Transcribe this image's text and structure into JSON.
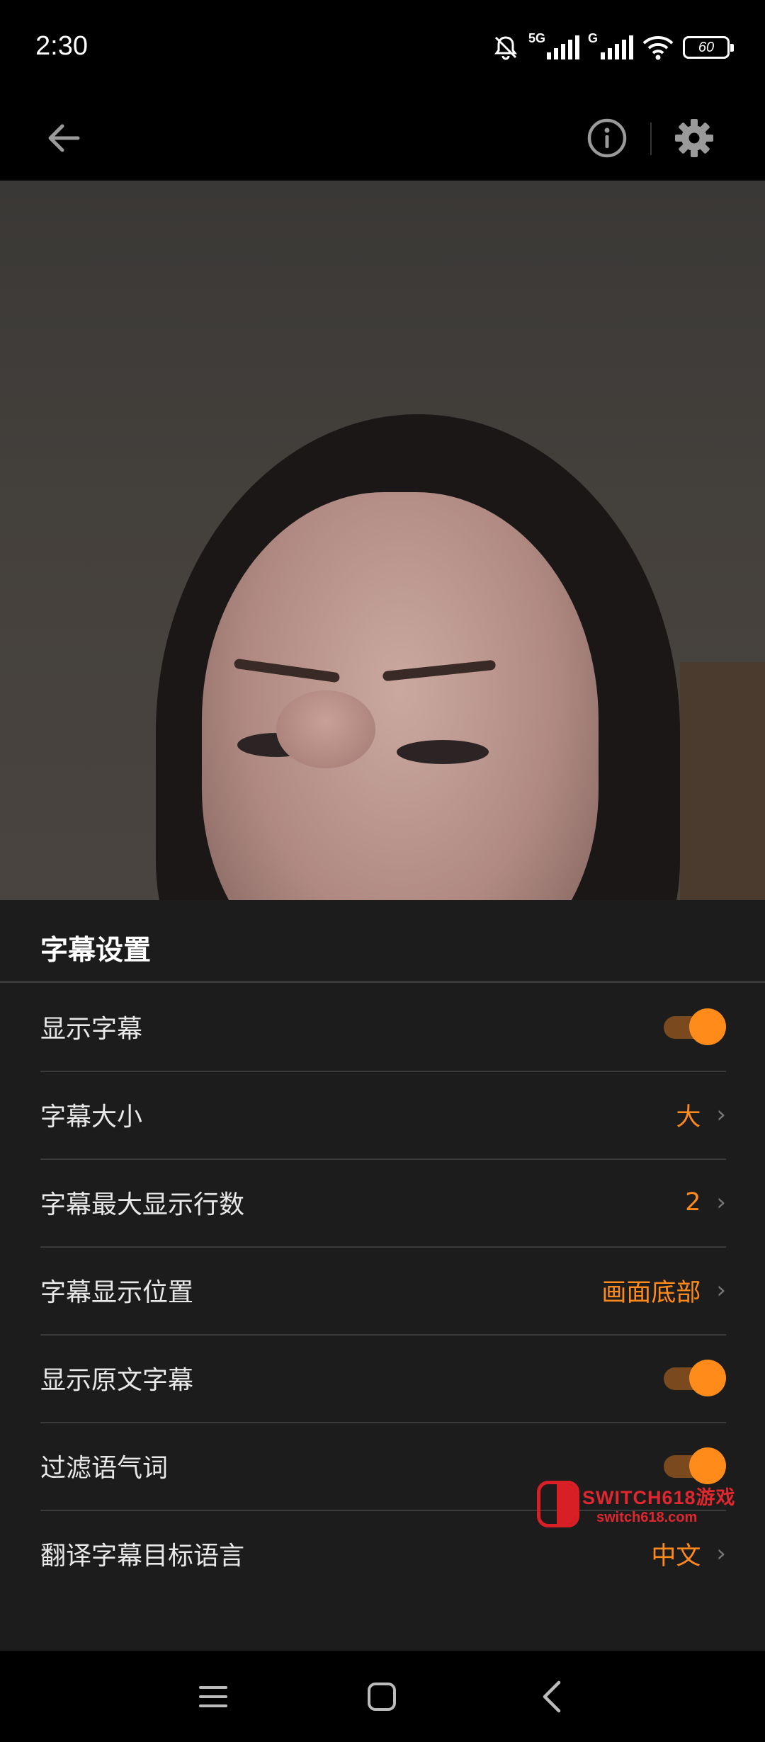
{
  "status_bar": {
    "time": "2:30",
    "network_1": "5G",
    "network_2": "G",
    "battery": "60"
  },
  "toolbar": {
    "icons": [
      "back-arrow-icon",
      "info-icon",
      "gear-icon"
    ]
  },
  "settings": {
    "title": "字幕设置",
    "rows": [
      {
        "label": "显示字幕",
        "type": "toggle",
        "on": true
      },
      {
        "label": "字幕大小",
        "type": "value",
        "value": "大"
      },
      {
        "label": "字幕最大显示行数",
        "type": "value",
        "value": "2"
      },
      {
        "label": "字幕显示位置",
        "type": "value",
        "value": "画面底部"
      },
      {
        "label": "显示原文字幕",
        "type": "toggle",
        "on": true
      },
      {
        "label": "过滤语气词",
        "type": "toggle",
        "on": true
      },
      {
        "label": "翻译字幕目标语言",
        "type": "value",
        "value": "中文"
      }
    ],
    "chevron": "›"
  },
  "watermark": {
    "line1": "SWITCH618游戏",
    "line2": "switch618.com"
  },
  "colors": {
    "accent": "#ff8c1a",
    "sheet_bg": "#1c1c1c"
  }
}
